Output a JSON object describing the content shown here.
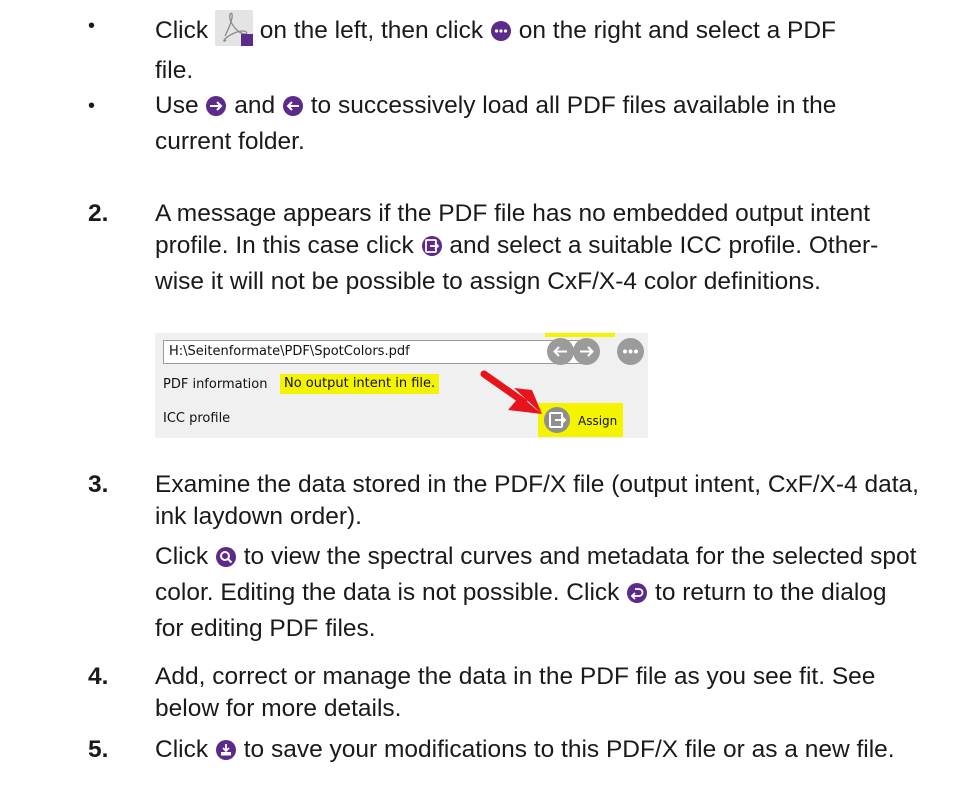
{
  "bullets": [
    {
      "before": "Click",
      "mid1": "on the left, then click",
      "mid2": "on the right and select a PDF",
      "line2": "file."
    },
    {
      "before": "Use",
      "mid1": "and",
      "mid2": "to successively load all PDF files available in the",
      "line2": "current folder."
    }
  ],
  "step2": {
    "number": "2.",
    "line1": "A message appears if the PDF file has no embedded output intent",
    "line2a": "profile. In this case click",
    "line2b": "and select a suitable ICC profile. Other-",
    "line3": "wise it will not be possible to assign CxF/X-4 color definitions."
  },
  "screenshot": {
    "file_path": "H:\\Seitenformate\\PDF\\SpotColors.pdf",
    "pdf_info_label": "PDF information",
    "pdf_info_value": "No output intent in file.",
    "icc_label": "ICC profile",
    "assign_label": "Assign"
  },
  "step3": {
    "number": "3.",
    "line1": "Examine the data stored in the PDF/X file (output intent, CxF/X-4 data,",
    "line2": "ink laydown order).",
    "p2_1a": "Click",
    "p2_1b": "to view the spectral curves and metadata for the selected spot",
    "p2_2a": "color. Editing the data is not possible. Click",
    "p2_2b": "to return to the dialog",
    "p2_3": "for editing PDF files."
  },
  "step4": {
    "number": "4.",
    "line1": "Add, correct or manage the data in the PDF file as you see fit. See",
    "line2": "below for more details."
  },
  "step5": {
    "number": "5.",
    "a": "Click",
    "b": "to save your modifications to this PDF/X file or as a new file."
  },
  "colors": {
    "purple": "#5b2a8a",
    "yellow": "#f4f400",
    "red": "#e8141c",
    "gray": "#9b9b9b"
  }
}
